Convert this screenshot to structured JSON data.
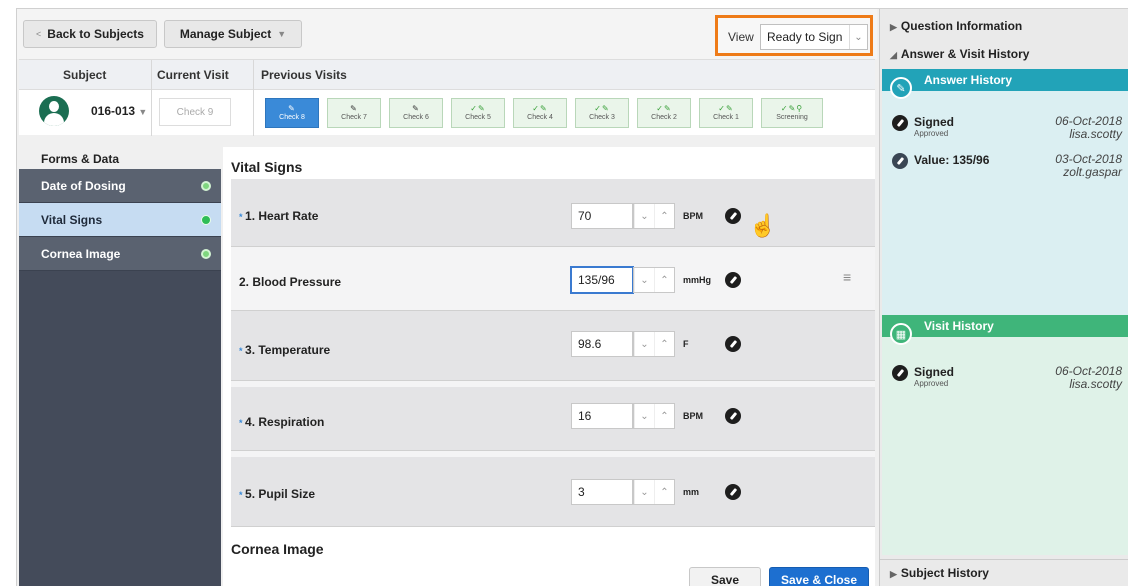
{
  "toolbar": {
    "back_label": "Back to Subjects",
    "back_caret": "<",
    "manage_label": "Manage Subject",
    "view_label": "View",
    "view_value": "Ready to Sign"
  },
  "visits": {
    "subject_header": "Subject",
    "current_header": "Current Visit",
    "previous_header": "Previous Visits",
    "subject_id": "016-013",
    "current_visit": "Check 9",
    "chips": [
      {
        "label": "Check 8",
        "icons": "✎",
        "active": true
      },
      {
        "label": "Check 7",
        "icons": "✎"
      },
      {
        "label": "Check 6",
        "icons": "✎"
      },
      {
        "label": "Check 5",
        "icons": "✓✎"
      },
      {
        "label": "Check 4",
        "icons": "✓✎"
      },
      {
        "label": "Check 3",
        "icons": "✓✎"
      },
      {
        "label": "Check 2",
        "icons": "✓✎"
      },
      {
        "label": "Check 1",
        "icons": "✓✎"
      },
      {
        "label": "Screening",
        "icons": "✓✎⚲"
      }
    ]
  },
  "sidebar": {
    "title": "Forms & Data",
    "items": [
      {
        "label": "Date of Dosing"
      },
      {
        "label": "Vital Signs"
      },
      {
        "label": "Cornea Image"
      }
    ]
  },
  "form": {
    "section_title": "Vital Signs",
    "fields": [
      {
        "label": "1. Heart Rate",
        "value": "70",
        "unit": "BPM",
        "required": true
      },
      {
        "label": "2. Blood Pressure",
        "value": "135/96",
        "unit": "mmHg",
        "required": false
      },
      {
        "label": "3. Temperature",
        "value": "98.6",
        "unit": "F",
        "required": true
      },
      {
        "label": "4. Respiration",
        "value": "16",
        "unit": "BPM",
        "required": true
      },
      {
        "label": "5. Pupil Size",
        "value": "3",
        "unit": "mm",
        "required": true
      }
    ],
    "next_section": "Cornea Image",
    "save_label": "Save",
    "save_close_label": "Save & Close"
  },
  "right_panel": {
    "question_info": "Question Information",
    "answer_visit_history": "Answer & Visit History",
    "answer_history_title": "Answer History",
    "answer_items": [
      {
        "main": "Signed",
        "sub": "Approved",
        "date": "06-Oct-2018",
        "user": "lisa.scotty"
      },
      {
        "main": "Value: 135/96",
        "sub": "",
        "date": "03-Oct-2018",
        "user": "zolt.gaspar"
      }
    ],
    "visit_history_title": "Visit History",
    "visit_items": [
      {
        "main": "Signed",
        "sub": "Approved",
        "date": "06-Oct-2018",
        "user": "lisa.scotty"
      }
    ],
    "subject_history": "Subject History"
  },
  "colors": {
    "accent_blue": "#1d6fd0",
    "view_highlight": "#ee7b18",
    "answer_teal": "#22a3b8",
    "visit_green": "#3fb57a",
    "sidebar_dark": "#444b5a"
  }
}
